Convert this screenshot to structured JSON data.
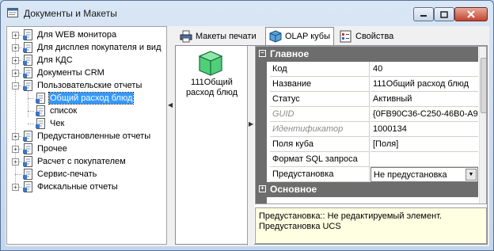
{
  "window": {
    "title": "Документы и Макеты",
    "icon": "documents-app-icon"
  },
  "tree": {
    "items": [
      {
        "label": "Для WEB монитора",
        "expandable": true
      },
      {
        "label": "Для дисплея покупателя и вид",
        "expandable": true
      },
      {
        "label": "Для КДС",
        "expandable": true
      },
      {
        "label": "Документы CRM",
        "expandable": true
      },
      {
        "label": "Пользовательские отчеты",
        "expandable": true,
        "expanded": true
      },
      {
        "label": "Общий расход блюд",
        "child": true,
        "selected": true
      },
      {
        "label": "список",
        "child": true
      },
      {
        "label": "Чек",
        "child": true
      },
      {
        "label": "Предустановленные отчеты",
        "expandable": true
      },
      {
        "label": "Прочее",
        "expandable": true
      },
      {
        "label": "Расчет с покупателем",
        "expandable": true
      },
      {
        "label": "Сервис-печать",
        "expandable": false
      },
      {
        "label": "Фискальные отчеты",
        "expandable": true
      }
    ]
  },
  "tabs": [
    {
      "label": "Макеты печати",
      "icon": "printer-icon"
    },
    {
      "label": "OLAP кубы",
      "icon": "cube-icon",
      "active": true
    },
    {
      "label": "Свойства",
      "icon": "properties-icon"
    }
  ],
  "olap": {
    "caption": "111Общий расход блюд"
  },
  "grid": {
    "categories": {
      "main": "Главное",
      "basic": "Основное"
    },
    "rows": [
      {
        "name": "Код",
        "value": "40"
      },
      {
        "name": "Название",
        "value": "111Общий расход блюд"
      },
      {
        "name": "Статус",
        "value": "Активный"
      },
      {
        "name": "GUID",
        "value": "{0FB90C36-C250-46B0-A9",
        "readonly": true
      },
      {
        "name": "Идентификатор",
        "value": "1000134",
        "readonly": true
      },
      {
        "name": "Поля куба",
        "value": "[Поля]"
      },
      {
        "name": "Формат SQL запроса",
        "value": ""
      },
      {
        "name": "Предустановка",
        "value": "Не предустановка",
        "editing": true
      }
    ]
  },
  "description": {
    "line1": "Предустановка:: Не редактируемый элемент.",
    "line2": "Предустановка UCS"
  },
  "colors": {
    "selection": "#3399ff",
    "category_bar": "#6d6d6d",
    "description_bg": "#ffffe1",
    "close_button": "#c4452e"
  }
}
